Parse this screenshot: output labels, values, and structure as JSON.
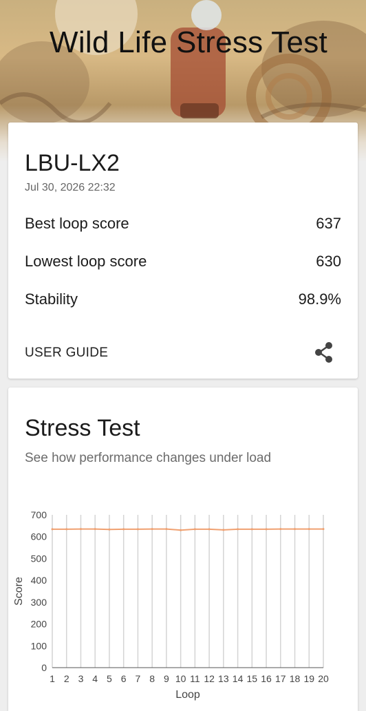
{
  "header": {
    "title": "Wild Life Stress Test"
  },
  "result": {
    "device": "LBU-LX2",
    "date": "Jul 30, 2026 22:32",
    "rows": [
      {
        "label": "Best loop score",
        "value": "637"
      },
      {
        "label": "Lowest loop score",
        "value": "630"
      },
      {
        "label": "Stability",
        "value": "98.9%"
      }
    ],
    "user_guide_label": "USER GUIDE",
    "share_icon": "share-icon"
  },
  "stress": {
    "title": "Stress Test",
    "subtitle": "See how performance changes under load"
  },
  "chart_data": {
    "type": "line",
    "x": [
      1,
      2,
      3,
      4,
      5,
      6,
      7,
      8,
      9,
      10,
      11,
      12,
      13,
      14,
      15,
      16,
      17,
      18,
      19,
      20
    ],
    "series": [
      {
        "values": [
          634,
          634,
          635,
          635,
          633,
          634,
          634,
          635,
          635,
          630,
          634,
          634,
          631,
          634,
          634,
          634,
          635,
          635,
          635,
          635
        ],
        "color": "#f0a070"
      }
    ],
    "xlabel": "Loop",
    "ylabel": "Score",
    "ylim": [
      0,
      700
    ],
    "yticks": [
      0,
      100,
      200,
      300,
      400,
      500,
      600,
      700
    ],
    "grid": "vertical"
  },
  "colors": {
    "accent": "#f0a070",
    "grid": "#d4d4d4"
  }
}
